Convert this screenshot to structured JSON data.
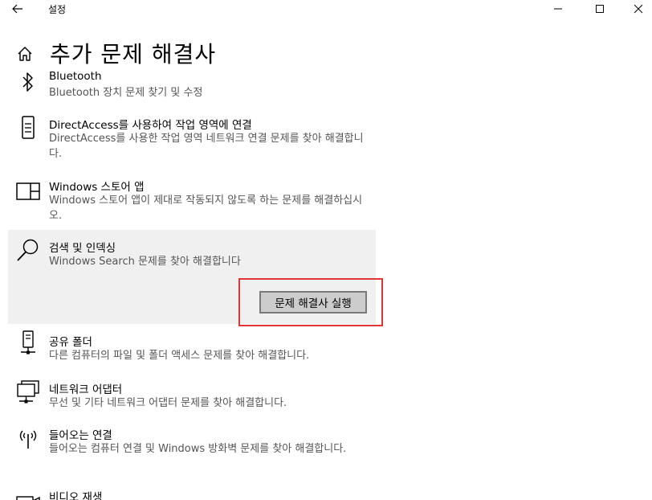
{
  "window": {
    "title": "설정"
  },
  "page": {
    "title": "추가 문제 해결사"
  },
  "items": [
    {
      "name": "Bluetooth",
      "desc": "Bluetooth 장치 문제 찾기 및 수정"
    },
    {
      "name": "DirectAccess를 사용하여 작업 영역에 연결",
      "desc": "DirectAccess를 사용한 작업 영역 네트워크 연결 문제를 찾아 해결합니다."
    },
    {
      "name": "Windows 스토어 앱",
      "desc": "Windows 스토어 앱이 제대로 작동되지 않도록 하는 문제를 해결하십시오."
    },
    {
      "name": "검색 및 인덱싱",
      "desc": "Windows Search 문제를 찾아 해결합니다"
    },
    {
      "name": "공유 폴더",
      "desc": "다른 컴퓨터의 파일 및 폴더 액세스 문제를 찾아 해결합니다."
    },
    {
      "name": "네트워크 어댑터",
      "desc": "무선 및 기타 네트워크 어댑터 문제를 찾아 해결합니다."
    },
    {
      "name": "들어오는 연결",
      "desc": "들어오는 컴퓨터 연결 및 Windows 방화벽 문제를 찾아 해결합니다."
    },
    {
      "name": "비디오 재생",
      "desc": ""
    }
  ],
  "selected": {
    "run_label": "문제 해결사 실행"
  },
  "icons": {
    "back": "back-arrow-icon",
    "minimize": "minimize-icon",
    "maximize": "maximize-icon",
    "close": "close-icon",
    "home": "home-icon",
    "bluetooth": "bluetooth-icon",
    "directaccess": "phone-device-icon",
    "store": "store-app-icon",
    "search": "search-icon",
    "shared_folder": "shared-folder-icon",
    "network_adapter": "network-adapter-icon",
    "incoming": "antenna-icon",
    "video": "video-icon"
  },
  "colors": {
    "selected_bg": "#f0f0f0",
    "button_bg": "#cccccc",
    "highlight": "#e0333a",
    "desc_text": "#555555"
  }
}
